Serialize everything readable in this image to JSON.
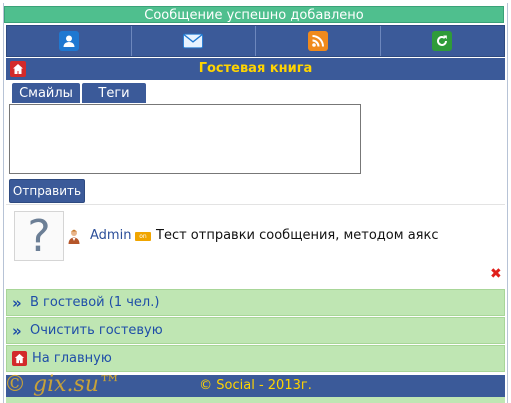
{
  "notice": "Сообщение успешно добавлено",
  "iconbar": {
    "items": [
      {
        "icon": "user-icon",
        "color": "#1f78d1"
      },
      {
        "icon": "mail-icon",
        "color": "#1f78d1"
      },
      {
        "icon": "rss-icon",
        "color": "#f08a1c"
      },
      {
        "icon": "refresh-icon",
        "color": "#2f9b3a"
      }
    ]
  },
  "header": {
    "title": "Гостевая книга"
  },
  "tabs": {
    "smiles": "Смайлы",
    "tags": "Теги"
  },
  "form": {
    "message_value": "",
    "send_label": "Отправить"
  },
  "post": {
    "avatar_glyph": "?",
    "author": "Admin",
    "status_badge": "on",
    "text": "Тест отправки сообщения, методом аякс",
    "delete_glyph": "✖"
  },
  "links": {
    "guests": "В гостевой (1 чел.)",
    "clear": "Очистить гостевую",
    "home": "На главную"
  },
  "footer": {
    "text": "© Social - 2013г."
  },
  "watermark": "© gix.su™",
  "colors": {
    "accent": "#3b5a99",
    "title": "#ffd400",
    "success": "#4fbf8e",
    "link_bg": "#bfe6b3",
    "link": "#1f4ea8"
  }
}
